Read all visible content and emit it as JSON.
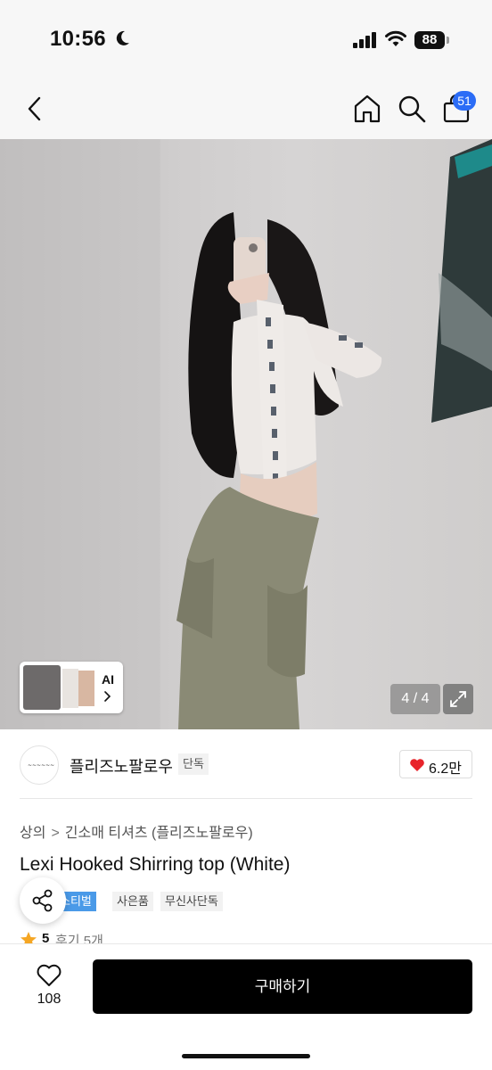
{
  "status_bar": {
    "time": "10:56",
    "battery_level": "88",
    "icons": [
      "moon-icon",
      "signal-icon",
      "wifi-icon",
      "battery-icon"
    ]
  },
  "nav": {
    "icons": [
      "chevron-left-icon",
      "home-icon",
      "search-icon",
      "shopping-bag-icon"
    ],
    "cart_count": "51"
  },
  "gallery": {
    "ai_label": "AI",
    "counter": "4 / 4",
    "icons": [
      "chevron-right-icon",
      "expand-icon"
    ]
  },
  "brand": {
    "name": "플리즈노팔로우",
    "tag": "단독",
    "likes": "6.2만",
    "heart_color": "#e8242b"
  },
  "product": {
    "breadcrumb": [
      "상의",
      "긴소매 티셔츠 (플리즈노팔로우)"
    ],
    "title": "Lexi Hooked Shirring top (White)",
    "badges": {
      "festival": "스티벌",
      "gift": "사은품",
      "exclusive": "무신사단독"
    },
    "badge_color": "#4a9ae8",
    "rating": "5",
    "reviews": "후기 5개",
    "star_color": "#f5a623"
  },
  "bottom_bar": {
    "wish_count": "108",
    "buy_label": "구매하기"
  }
}
